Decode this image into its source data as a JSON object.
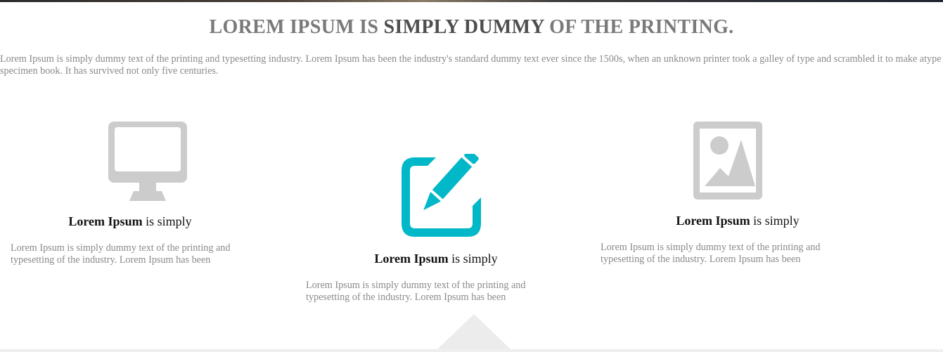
{
  "section": {
    "title_part1": "LOREM IPSUM IS ",
    "title_part2": "SIMPLY DUMMY",
    "title_part3": " OF THE PRINTING.",
    "intro": "Lorem Ipsum is simply dummy text of the printing and typesetting industry. Lorem Ipsum has been the industry's standard dummy text ever since the 1500s, when an unknown printer took a galley of type and scrambled it to make atype specimen book. It has survived not only five centuries."
  },
  "features": [
    {
      "icon": "monitor-icon",
      "heading_bold": "Lorem Ipsum",
      "heading_rest": " is simply",
      "text": "Lorem Ipsum is simply dummy text of the printing and typesetting of the industry. Lorem Ipsum has been",
      "color": "#cccccc"
    },
    {
      "icon": "edit-icon",
      "heading_bold": "Lorem Ipsum",
      "heading_rest": " is simply",
      "text": "Lorem Ipsum is simply dummy text of the printing and typesetting of the industry. Lorem Ipsum has been",
      "color": "#00b8c8"
    },
    {
      "icon": "image-icon",
      "heading_bold": "Lorem Ipsum",
      "heading_rest": " is simply",
      "text": "Lorem Ipsum is simply dummy text of the printing and typesetting of the industry. Lorem Ipsum has been",
      "color": "#cccccc"
    }
  ]
}
